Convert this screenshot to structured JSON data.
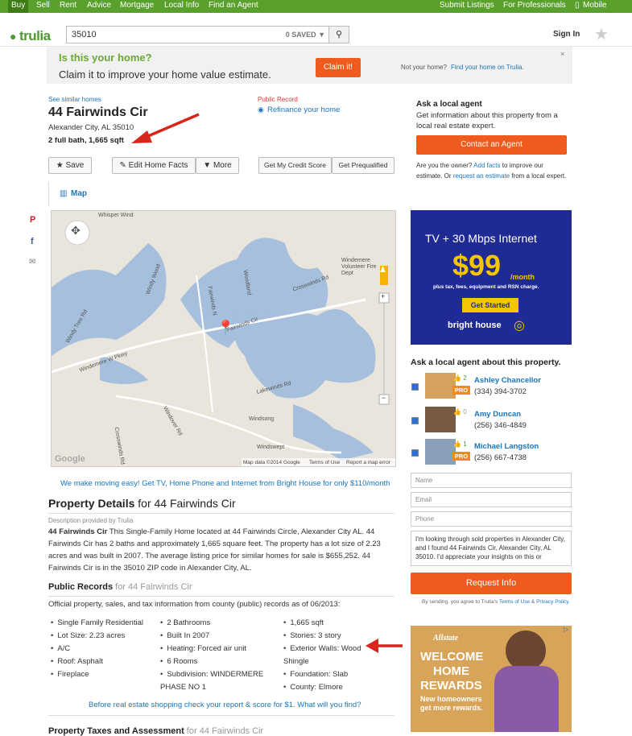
{
  "topnav": {
    "left": [
      "Buy",
      "Sell",
      "Rent",
      "Advice",
      "Mortgage",
      "Local Info",
      "Find an Agent"
    ],
    "right": [
      "Submit Listings",
      "For Professionals",
      "Mobile"
    ]
  },
  "header": {
    "logo": "trulia",
    "search_value": "35010",
    "saved": "0 SAVED ▼",
    "signin": "Sign In"
  },
  "banner": {
    "question": "Is this your home?",
    "subtitle": "Claim it to improve your home value estimate.",
    "claim": "Claim it!",
    "not_your_home": "Not your home?",
    "find_link": "Find your home on Trulia."
  },
  "property": {
    "see_similar": "See similar homes",
    "address": "44 Fairwinds Cir",
    "city": "Alexander City, AL 35010",
    "facts": "2 full bath, 1,665 sqft",
    "public_record": "Public Record",
    "refinance": "Refinance your home",
    "save": "Save",
    "edit_facts": "Edit Home Facts",
    "more": "More",
    "credit_score": "Get My Credit Score",
    "prequalified": "Get Prequalified",
    "map_tab": "Map"
  },
  "map": {
    "labels": [
      "Whisper Wind",
      "Fairwinds N",
      "Woodland",
      "Windy Wood",
      "Crosswinds Rd",
      "Windemere Volunteer Fire Dept",
      "Fairwinds Cir",
      "Windy Tree Rd",
      "Windemere W Pkwy",
      "Lakewinds Rd",
      "Windover Rd",
      "Windsong",
      "Windswept",
      "Crosswinds Rd"
    ],
    "footer": [
      "Map data ©2014 Google",
      "Terms of Use",
      "Report a map error"
    ],
    "google": "Google"
  },
  "promo": "We make moving easy! Get TV, Home Phone and Internet from Bright House for only $110/month",
  "details": {
    "title": "Property Details",
    "for": " for 44 Fairwinds Cir",
    "provided": "Description provided by Trulia",
    "bold": "44 Fairwinds Cir",
    "text": " This Single-Family Home located at 44 Fairwinds Circle, Alexander City AL. 44 Fairwinds Cir has 2 baths and approximately 1,665 square feet. The property has a lot size of 2.23 acres and was built in 2007. The average listing price for similar homes for sale is $655,252. 44 Fairwinds Cir is in the 35010 ZIP code in Alexander City, AL."
  },
  "records": {
    "title": "Public Records",
    "for": " for 44 Fairwinds Cir",
    "intro": "Official property, sales, and tax information from county (public) records as of 06/2013:",
    "col1": [
      "Single Family Residential",
      "Lot Size: 2.23 acres",
      "A/C",
      "Roof: Asphalt",
      "Fireplace"
    ],
    "col2": [
      "2 Bathrooms",
      "Built In 2007",
      "Heating: Forced air unit",
      "6 Rooms",
      "Subdivision: WINDERMERE PHASE NO 1"
    ],
    "col3": [
      "1,665 sqft",
      "Stories: 3 story",
      "Exterior Walls: Wood Shingle",
      "Foundation: Slab",
      "County: Elmore"
    ],
    "cta": "Before real estate shopping check your report & score for $1. What will you find?"
  },
  "taxes": {
    "title": "Property Taxes and Assessment",
    "for": " for 44 Fairwinds Cir"
  },
  "ask_agent": {
    "title": "Ask a local agent",
    "text": "Get information about this property from a local real estate expert.",
    "button": "Contact an Agent",
    "owner_pre": "Are you the owner?",
    "add_facts": "Add facts",
    "owner_mid": "to improve our estimate. Or",
    "request_estimate": "request an estimate",
    "owner_post": "from a local expert."
  },
  "ad1": {
    "line1": "TV + 30 Mbps Internet",
    "price": "$99",
    "per": "/month",
    "fine": "plus tax, fees, equipment and RSN charge.",
    "cta": "Get Started",
    "brand": "bright house"
  },
  "agents": {
    "title": "Ask a local agent about this property.",
    "list": [
      {
        "name": "Ashley Chancellor",
        "phone": "(334) 394-3702",
        "likes": "2",
        "pro": "PRO"
      },
      {
        "name": "Amy Duncan",
        "phone": "(256) 346-4849",
        "likes": "0",
        "pro": ""
      },
      {
        "name": "Michael Langston",
        "phone": "(256) 667-4738",
        "likes": "1",
        "pro": "PRO"
      }
    ]
  },
  "form": {
    "name": "Name",
    "email": "Email",
    "phone": "Phone",
    "message": "I'm looking through sold properties in Alexander City, and I found 44 Fairwinds Cir, Alexander City, AL 35010. I'd appreciate your insights on this or",
    "button": "Request Info",
    "terms_pre": "By sending, you agree to Trulia's",
    "terms": "Terms of Use",
    "and": "&",
    "privacy": "Privacy Policy."
  },
  "ad2": {
    "brand": "Allstate",
    "line1": "WELCOME",
    "line2": "HOME",
    "line3": "REWARDS",
    "sub": "New homeowners get more rewards."
  },
  "social": [
    "pinterest-icon",
    "facebook-icon",
    "email-icon"
  ]
}
